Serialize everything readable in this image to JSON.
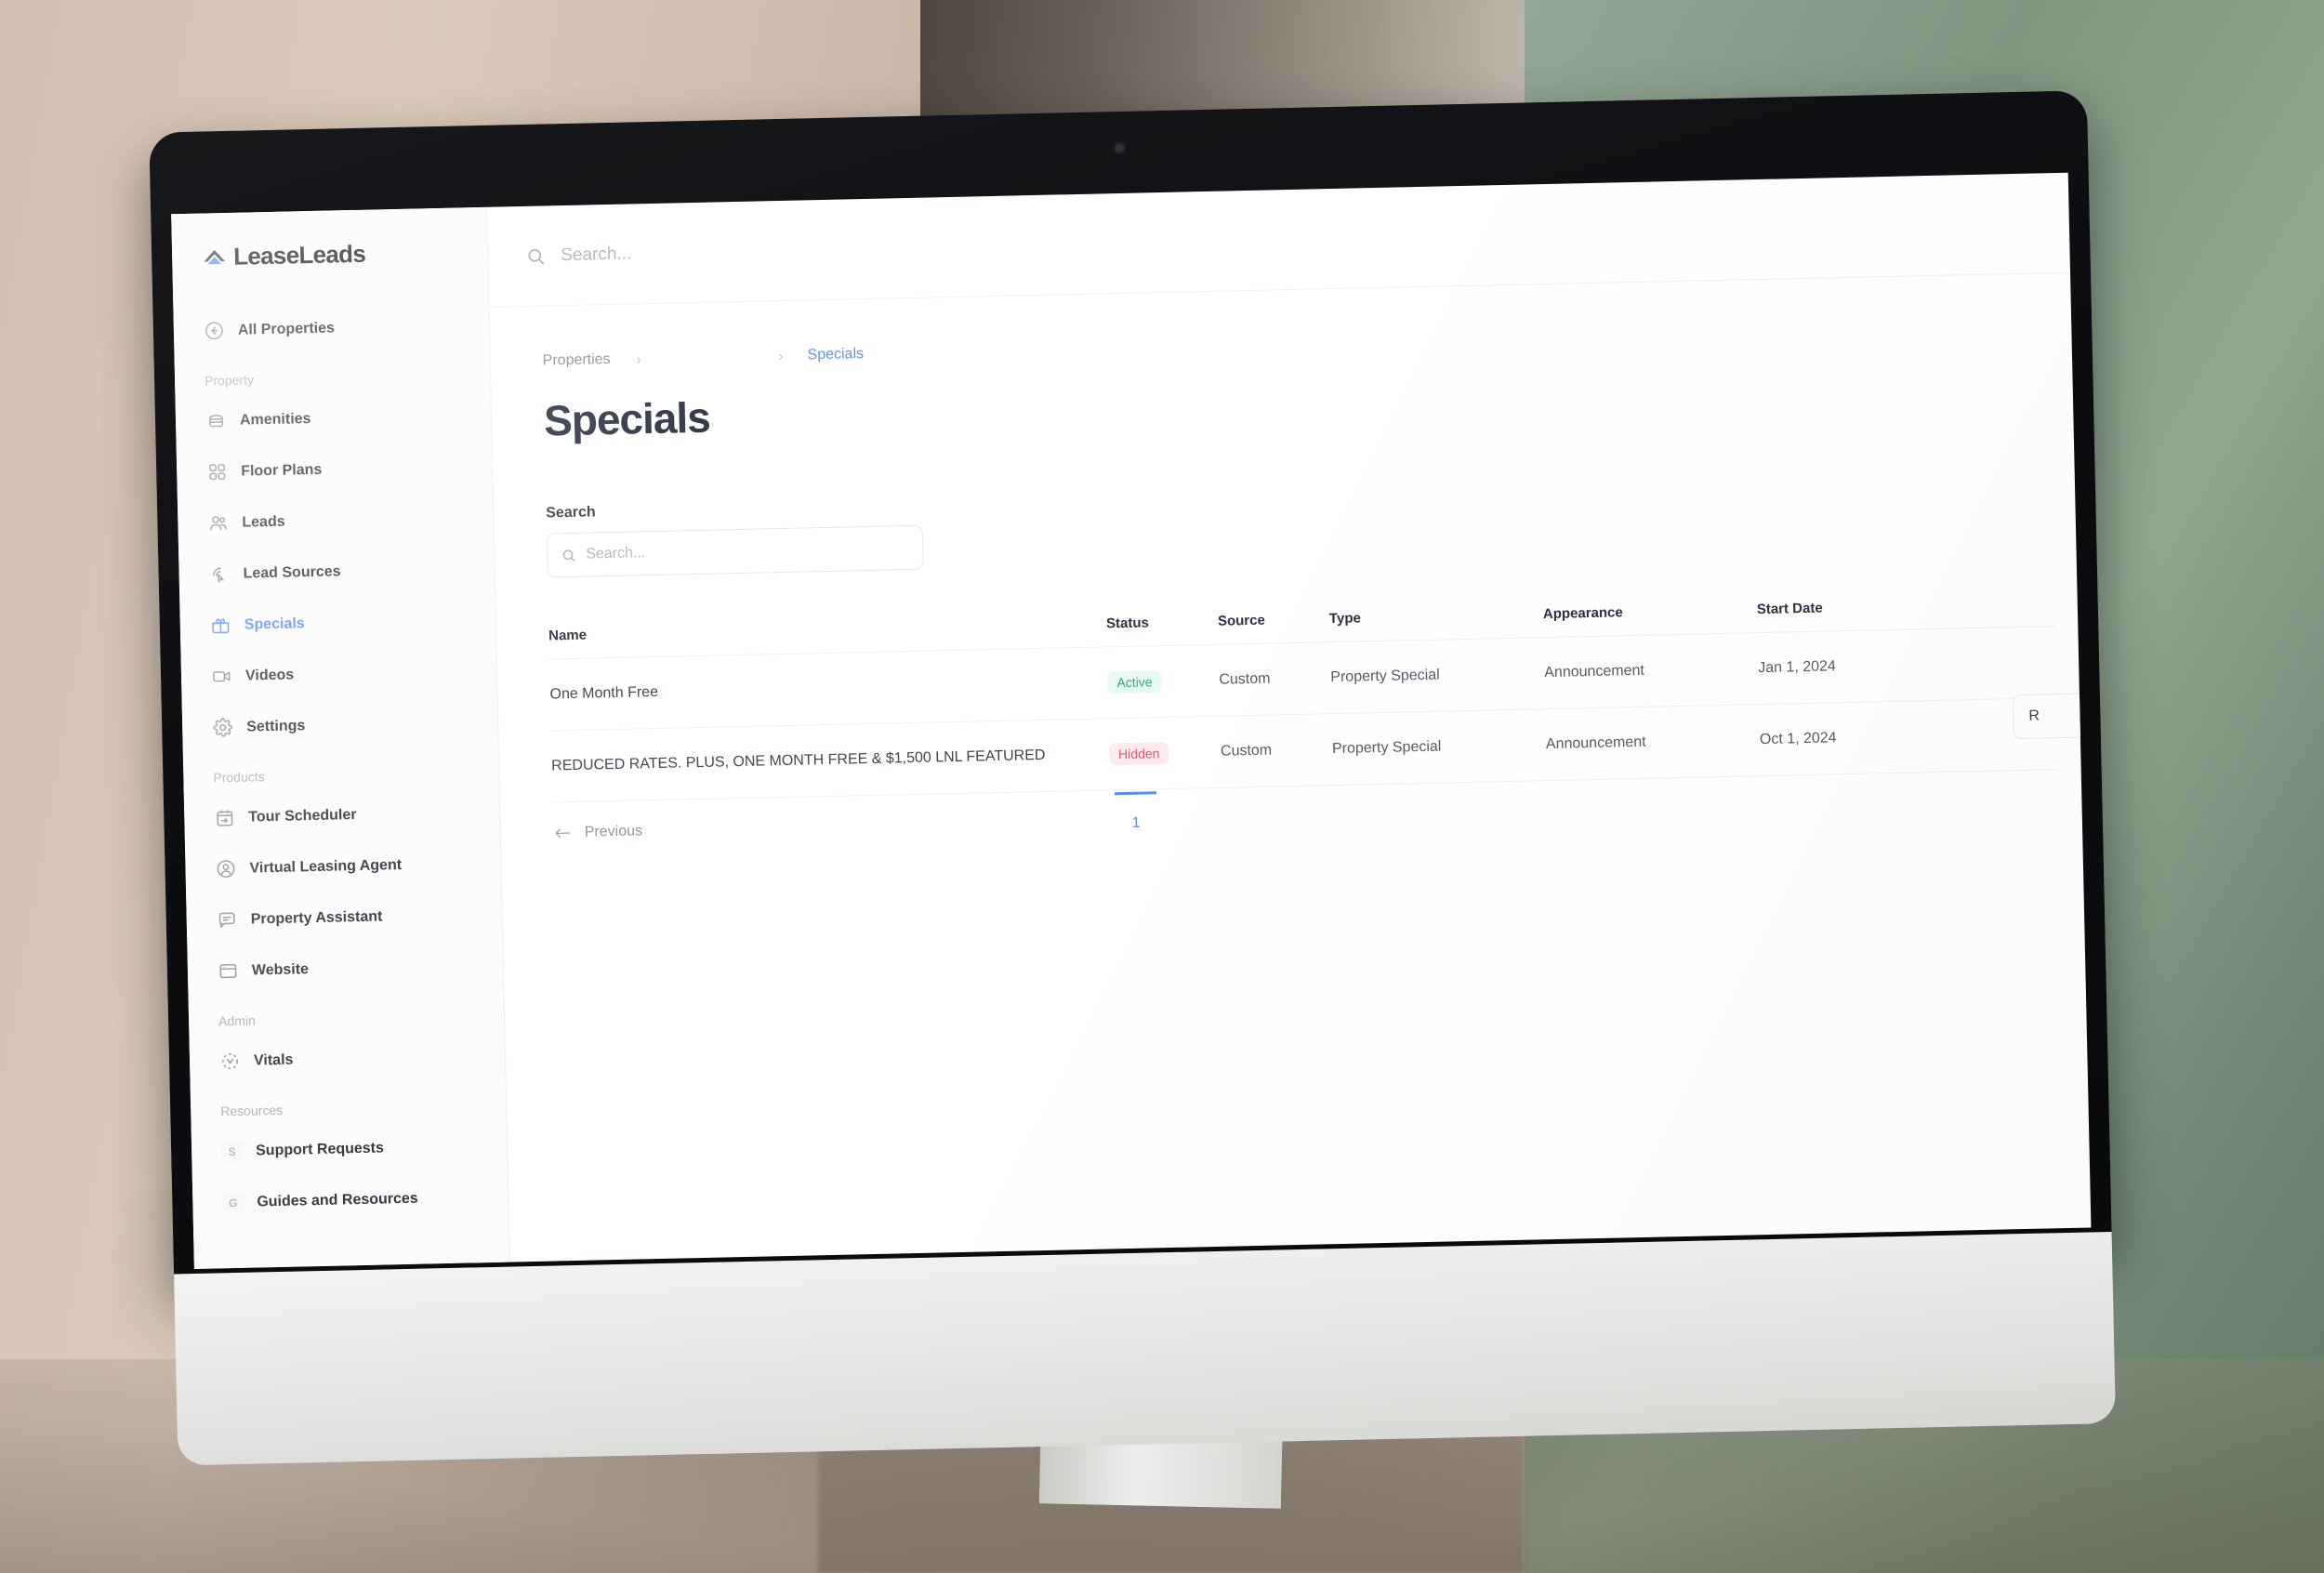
{
  "brand": {
    "name": "LeaseLeads",
    "logo_icon": "house-chevron-logo",
    "accent": "#5b8def"
  },
  "topbar": {
    "search_icon": "search-icon",
    "search_placeholder": "Search...",
    "search_value": ""
  },
  "sidebar": {
    "back_item": {
      "label": "All Properties",
      "icon": "arrow-left-circle-icon"
    },
    "groups": [
      {
        "label": "Property",
        "items": [
          {
            "label": "Amenities",
            "icon": "amenities-icon",
            "active": false
          },
          {
            "label": "Floor Plans",
            "icon": "grid-squares-icon",
            "active": false
          },
          {
            "label": "Leads",
            "icon": "users-icon",
            "active": false
          },
          {
            "label": "Lead Sources",
            "icon": "cursor-signal-icon",
            "active": false
          },
          {
            "label": "Specials",
            "icon": "gift-icon",
            "active": true
          },
          {
            "label": "Videos",
            "icon": "video-camera-icon",
            "active": false
          },
          {
            "label": "Settings",
            "icon": "gear-icon",
            "active": false
          }
        ]
      },
      {
        "label": "Products",
        "items": [
          {
            "label": "Tour Scheduler",
            "icon": "calendar-icon",
            "active": false
          },
          {
            "label": "Virtual Leasing Agent",
            "icon": "user-circle-icon",
            "active": false
          },
          {
            "label": "Property Assistant",
            "icon": "chat-bubble-icon",
            "active": false
          },
          {
            "label": "Website",
            "icon": "browser-window-icon",
            "active": false
          }
        ]
      },
      {
        "label": "Admin",
        "items": [
          {
            "label": "Vitals",
            "icon": "vitals-dashed-circle-icon",
            "active": false
          }
        ]
      },
      {
        "label": "Resources",
        "items": [
          {
            "label": "Support Requests",
            "icon": "letter-s-icon",
            "active": false
          },
          {
            "label": "Guides and Resources",
            "icon": "letter-g-icon",
            "active": false
          }
        ]
      }
    ]
  },
  "breadcrumb": {
    "root": "Properties",
    "middle": "",
    "current": "Specials",
    "separator": "›"
  },
  "page": {
    "title": "Specials"
  },
  "filters": {
    "search_label": "Search",
    "search_placeholder": "Search...",
    "search_value": "",
    "search_icon": "search-icon",
    "side_button_label": "R"
  },
  "table": {
    "columns": [
      "Name",
      "Status",
      "Source",
      "Type",
      "Appearance",
      "Start Date",
      ""
    ],
    "rows": [
      {
        "name": "One Month Free",
        "status": "Active",
        "status_kind": "active",
        "source": "Custom",
        "type": "Property Special",
        "appearance": "Announcement",
        "start_date": "Jan 1, 2024",
        "end_date": ""
      },
      {
        "name": "REDUCED RATES. PLUS, ONE MONTH FREE & $1,500 LNL FEATURED",
        "status": "Hidden",
        "status_kind": "hidden",
        "source": "Custom",
        "type": "Property Special",
        "appearance": "Announcement",
        "start_date": "Oct 1, 2024",
        "end_date": ""
      }
    ]
  },
  "pagination": {
    "previous_label": "Previous",
    "previous_icon": "arrow-left-icon",
    "current_page": "1"
  }
}
